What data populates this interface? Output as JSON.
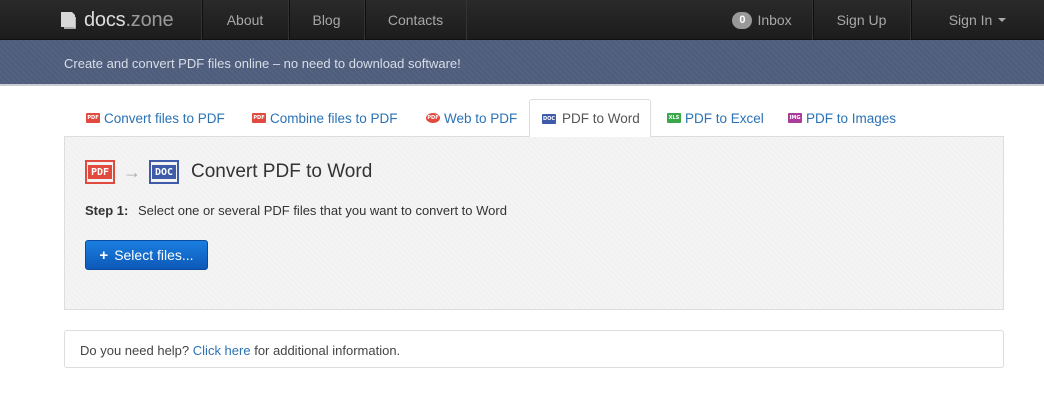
{
  "navbar": {
    "brand_main": "docs",
    "brand_suffix": ".zone",
    "about": "About",
    "blog": "Blog",
    "contacts": "Contacts",
    "inbox_count": "0",
    "inbox": "Inbox",
    "signup": "Sign Up",
    "signin": "Sign In"
  },
  "subheader": {
    "tagline": "Create and convert PDF files online – no need to download software!"
  },
  "tabs": [
    {
      "label": "Convert files to PDF",
      "icon": "pdf-file-icon",
      "color": "#e04a3f"
    },
    {
      "label": "Combine files to PDF",
      "icon": "combine-pdf-icon",
      "color": "#e04a3f"
    },
    {
      "label": "Web to PDF",
      "icon": "web-pdf-icon",
      "color": "#e04a3f"
    },
    {
      "label": "PDF to Word",
      "icon": "doc-file-icon",
      "color": "#3e5aa8"
    },
    {
      "label": "PDF to Excel",
      "icon": "xls-file-icon",
      "color": "#3aa84a"
    },
    {
      "label": "PDF to Images",
      "icon": "img-file-icon",
      "color": "#a83e9a"
    }
  ],
  "panel": {
    "from_badge": "PDF",
    "to_badge": "DOC",
    "title": "Convert PDF to Word",
    "step_label": "Step 1:",
    "step_text": "Select one or several PDF files that you want to convert to Word",
    "button": "Select files..."
  },
  "help": {
    "prefix": "Do you need help?",
    "link": "Click here",
    "suffix": "for additional information."
  },
  "colors": {
    "navbar": "#1f1f1f",
    "subheader": "#4e5d7c",
    "link": "#2a72b5",
    "button": "#1466c8"
  }
}
